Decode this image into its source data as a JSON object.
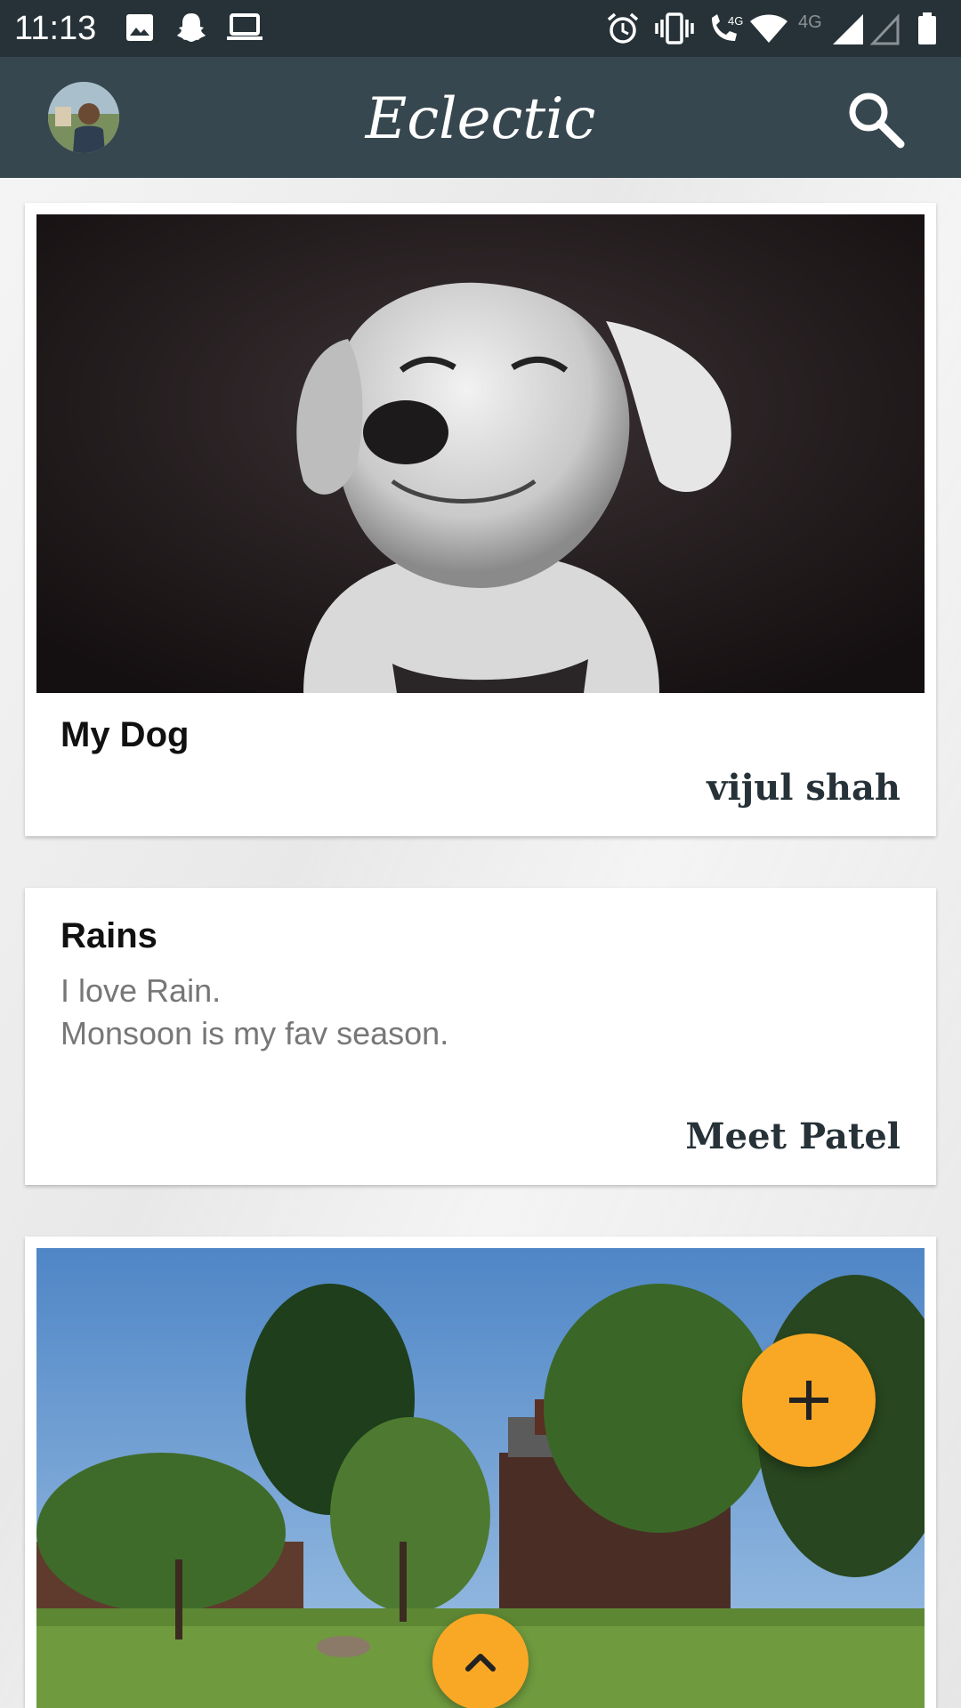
{
  "status_bar": {
    "time": "11:13",
    "network_label": "4G",
    "left_icons": [
      "image-icon",
      "snapchat-icon",
      "laptop-icon"
    ],
    "right_icons": [
      "alarm-icon",
      "vibrate-icon",
      "wifi-call-icon",
      "wifi-icon",
      "signal-icon",
      "signal-empty-icon",
      "battery-icon"
    ]
  },
  "app_bar": {
    "title": "Eclectic",
    "background": "#37474f",
    "search_icon": "search-icon"
  },
  "posts": [
    {
      "title": "My Dog",
      "author": "vijul shah",
      "image": "dog-photo"
    },
    {
      "title": "Rains",
      "body": "I love Rain.\nMonsoon is my fav season.",
      "author": "Meet Patel"
    },
    {
      "image": "campus-trees-photo"
    }
  ],
  "fab": {
    "add_icon": "plus-icon",
    "scroll_top_icon": "chevron-up-icon",
    "color": "#f9a825"
  }
}
